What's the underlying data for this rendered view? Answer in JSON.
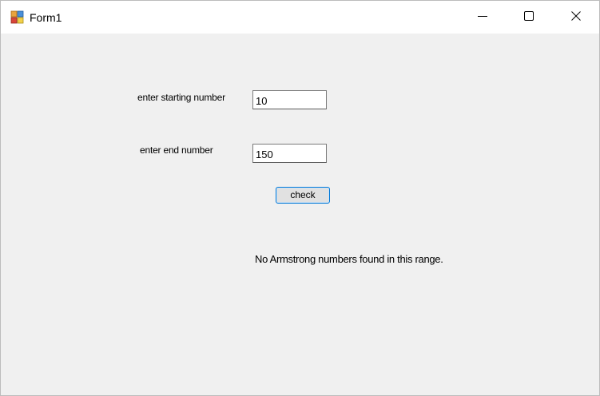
{
  "window": {
    "title": "Form1",
    "icon": "winforms-app-icon",
    "controls": {
      "minimize_icon": "minimize-icon",
      "maximize_icon": "maximize-icon",
      "close_icon": "close-icon"
    }
  },
  "form": {
    "start_label": "enter starting number",
    "start_value": "10",
    "end_label": "enter end number",
    "end_value": "150",
    "check_button": "check",
    "result_text": "No Armstrong numbers found in this range."
  },
  "colors": {
    "form_background": "#f0f0f0",
    "titlebar_background": "#ffffff",
    "button_focus_border": "#0078d7"
  }
}
